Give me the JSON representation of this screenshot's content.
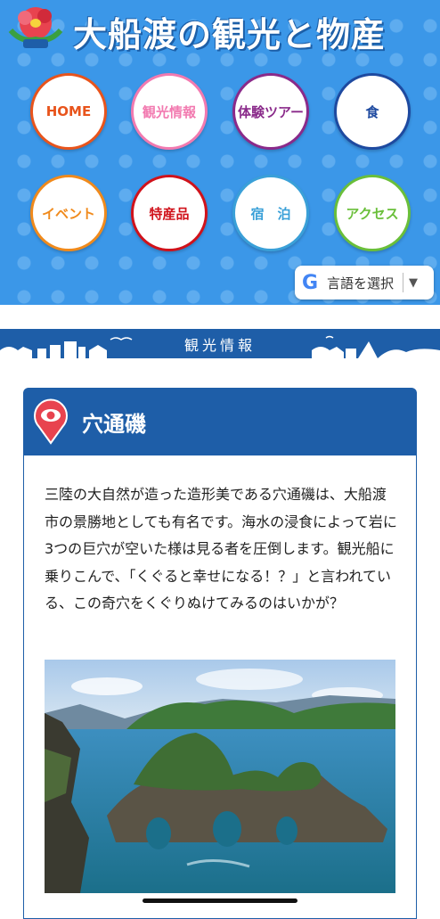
{
  "header": {
    "site_title": "大船渡の観光と物産",
    "nav": [
      {
        "label": "HOME",
        "color": "#e8541c"
      },
      {
        "label": "観光情報",
        "color": "#f27ab0"
      },
      {
        "label": "体験ツアー",
        "color": "#8a2a8a"
      },
      {
        "label": "食",
        "color": "#1e4aa0"
      },
      {
        "label": "イベント",
        "color": "#f08a1c"
      },
      {
        "label": "特産品",
        "color": "#d0121b"
      },
      {
        "label": "宿　泊",
        "color": "#3aa0d8"
      },
      {
        "label": "アクセス",
        "color": "#6abf3a"
      }
    ]
  },
  "language_selector": {
    "label": "言語を選択",
    "arrow": "▼",
    "icon": "google-icon"
  },
  "section_banner": {
    "label": "観光情報"
  },
  "article": {
    "icon": "eye-pin-icon",
    "title": "穴通磯",
    "description": "三陸の大自然が造った造形美である穴通磯は、大船渡市の景勝地としても有名です。海水の浸食によって岩に3つの巨穴が空いた様は見る者を圧倒します。観光船に乗りこんで、「くぐると幸せになる！？」と言われている、この奇穴をくぐりぬけてみるのはいかが？"
  }
}
